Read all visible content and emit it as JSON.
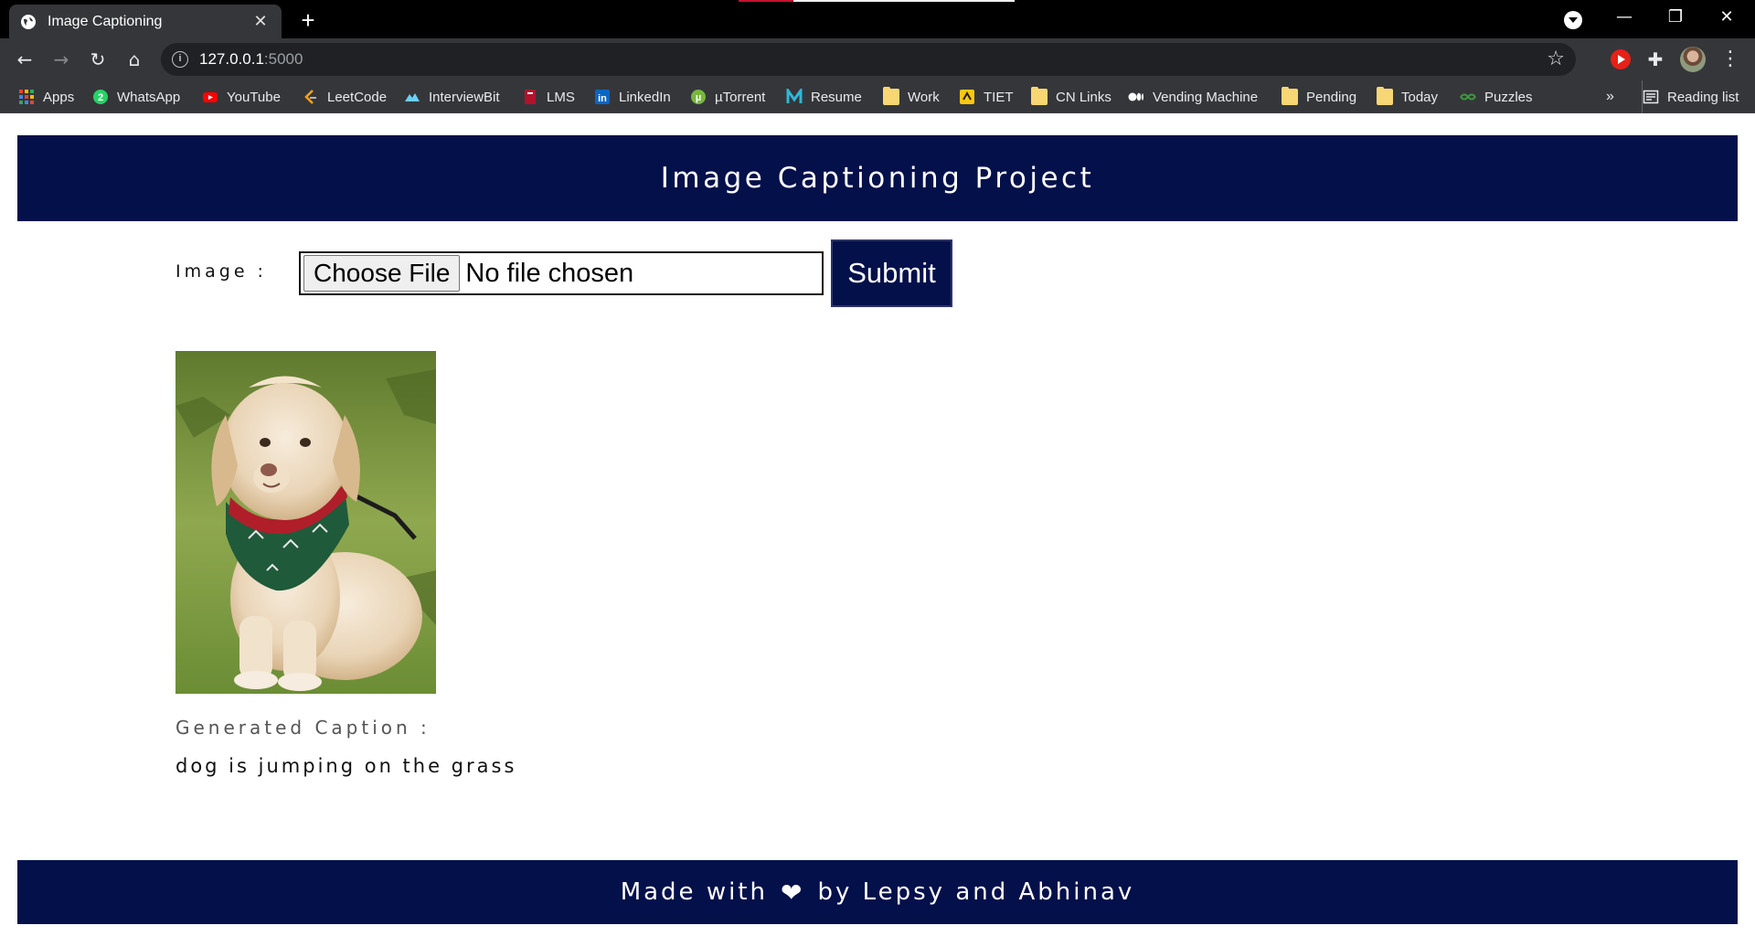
{
  "browser": {
    "tab_title": "Image Captioning",
    "new_tab": "+",
    "url_host": "127.0.0.1",
    "url_port": ":5000",
    "bookmarks": [
      {
        "label": "Apps",
        "icon": "apps-grid-icon"
      },
      {
        "label": "WhatsApp",
        "icon": "whatsapp-icon"
      },
      {
        "label": "YouTube",
        "icon": "youtube-icon"
      },
      {
        "label": "LeetCode",
        "icon": "leetcode-icon"
      },
      {
        "label": "InterviewBit",
        "icon": "interviewbit-icon"
      },
      {
        "label": "LMS",
        "icon": "lms-icon"
      },
      {
        "label": "LinkedIn",
        "icon": "linkedin-icon"
      },
      {
        "label": "µTorrent",
        "icon": "utorrent-icon"
      },
      {
        "label": "Resume",
        "icon": "resume-icon"
      },
      {
        "label": "Work",
        "icon": "folder-icon"
      },
      {
        "label": "TIET",
        "icon": "tiet-icon"
      },
      {
        "label": "CN Links",
        "icon": "folder-icon"
      },
      {
        "label": "Vending Machine",
        "icon": "medium-icon"
      },
      {
        "label": "Pending",
        "icon": "folder-icon"
      },
      {
        "label": "Today",
        "icon": "folder-icon"
      },
      {
        "label": "Puzzles",
        "icon": "puzzles-icon"
      }
    ],
    "overflow": "»",
    "reading_list": "Reading list"
  },
  "page": {
    "title": "Image Captioning Project",
    "image_label": "Image :",
    "choose_file": "Choose File",
    "file_status": "No file chosen",
    "submit": "Submit",
    "caption_label": "Generated Caption :",
    "caption": "dog is jumping on the grass",
    "footer_before": "Made with",
    "footer_after": "by Lepsy and Abhinav"
  },
  "colors": {
    "brand_navy": "#04104a",
    "chrome_dark": "#35363a"
  }
}
